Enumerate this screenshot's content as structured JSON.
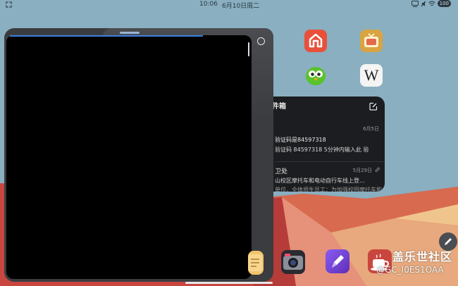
{
  "status_bar": {
    "time": "10:06",
    "date": "6月10日周二",
    "battery": "100"
  },
  "mail_widget": {
    "title": "件箱",
    "messages": [
      {
        "date": "6月5日",
        "subject": "验证码是84597318",
        "preview": "验证码 84597318 5分钟内输入此 验"
      },
      {
        "date": "5月29日",
        "subject": "卫处",
        "preview": "山校区摩托车和电动自行车线上登…",
        "preview2": "单位，全体师生员工：为加强校园摩托车和"
      }
    ]
  },
  "watermark": {
    "name": "盖乐世社区",
    "handle": "@GC_I0ES1OAA"
  },
  "colors": {
    "accent_blue": "#3d7fe0",
    "window_dark": "#3a3c40",
    "mail_bg": "#1c1d20"
  },
  "icons": {
    "app_1": "home-app-icon",
    "app_2": "tv-app-icon",
    "app_3": "owl-app-icon",
    "app_4": "wikipedia-app-icon",
    "dock_1": "notes-app-icon",
    "dock_2": "camera-app-icon",
    "dock_3": "pen-app-icon",
    "dock_4": "coffee-app-icon"
  },
  "wikipedia_letter": "W"
}
